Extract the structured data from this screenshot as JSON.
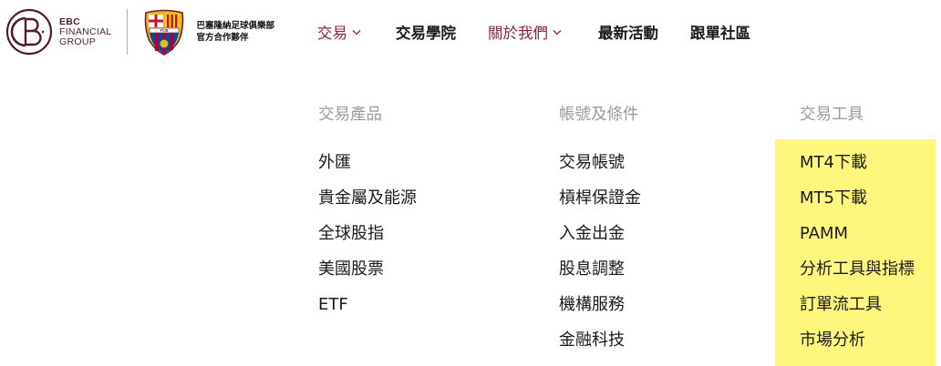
{
  "brand": {
    "line1": "EBC",
    "line2": "FINANCIAL",
    "line3": "GROUP",
    "partner_line1": "巴塞隆納足球俱樂部",
    "partner_line2": "官方合作夥伴",
    "crest_text": "FCB",
    "logo_color": "#4e1e2c"
  },
  "nav": {
    "items": [
      {
        "label": "交易"
      },
      {
        "label": "交易學院"
      },
      {
        "label": "關於我們"
      },
      {
        "label": "最新活動"
      },
      {
        "label": "跟單社區"
      }
    ],
    "accent_color": "#8c2335"
  },
  "menu": {
    "columns": [
      {
        "heading": "交易產品",
        "links": [
          "外匯",
          "貴金屬及能源",
          "全球股指",
          "美國股票",
          "ETF"
        ]
      },
      {
        "heading": "帳號及條件",
        "links": [
          "交易帳號",
          "槓桿保證金",
          "入金出金",
          "股息調整",
          "機構服務",
          "金融科技"
        ]
      },
      {
        "heading": "交易工具",
        "links": [
          "MT4下載",
          "MT5下載",
          "PAMM",
          "分析工具與指標",
          "訂單流工具",
          "市場分析"
        ],
        "highlight_color": "#fdf87d"
      }
    ]
  }
}
